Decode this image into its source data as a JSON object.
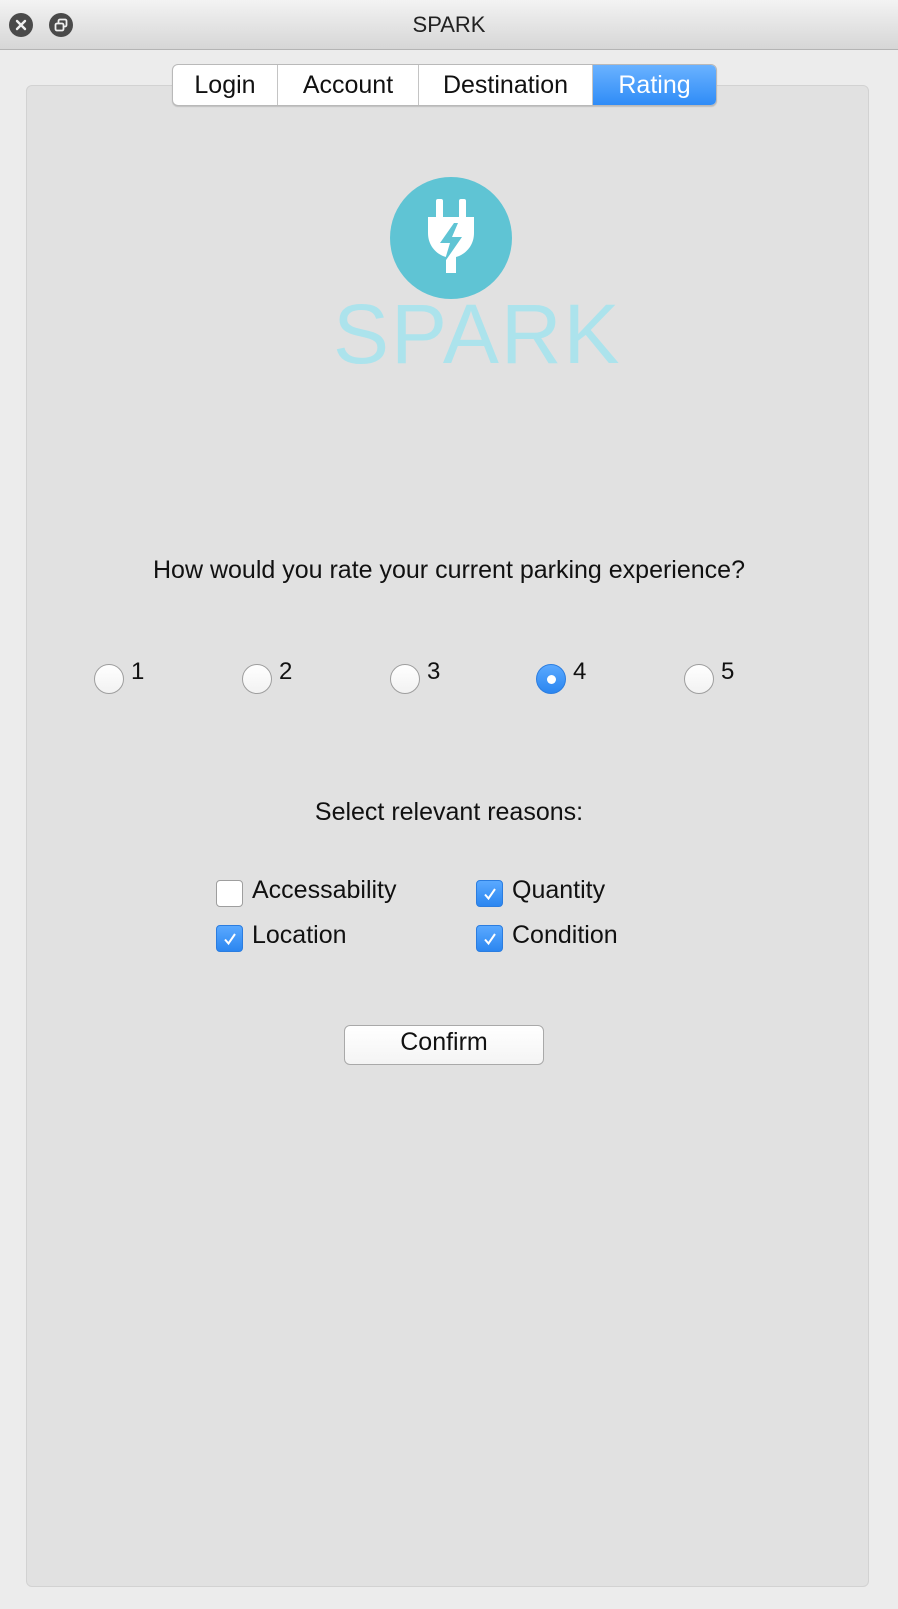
{
  "window": {
    "title": "SPARK"
  },
  "tabs": [
    {
      "label": "Login",
      "active": false
    },
    {
      "label": "Account",
      "active": false
    },
    {
      "label": "Destination",
      "active": false
    },
    {
      "label": "Rating",
      "active": true
    }
  ],
  "logo": {
    "wordmark": "SPARK",
    "icon": "plug-bolt-icon",
    "color": "#5fc4d4",
    "text_color": "#ace3ec"
  },
  "rating": {
    "question": "How would you rate your current parking experience?",
    "options": [
      "1",
      "2",
      "3",
      "4",
      "5"
    ],
    "selected": "4"
  },
  "reasons": {
    "title": "Select relevant reasons:",
    "items": [
      {
        "label": "Accessability",
        "checked": false
      },
      {
        "label": "Quantity",
        "checked": true
      },
      {
        "label": "Location",
        "checked": true
      },
      {
        "label": "Condition",
        "checked": true
      }
    ]
  },
  "actions": {
    "confirm_label": "Confirm"
  },
  "colors": {
    "accent": "#2f8cf7",
    "panel": "#e1e1e1"
  }
}
